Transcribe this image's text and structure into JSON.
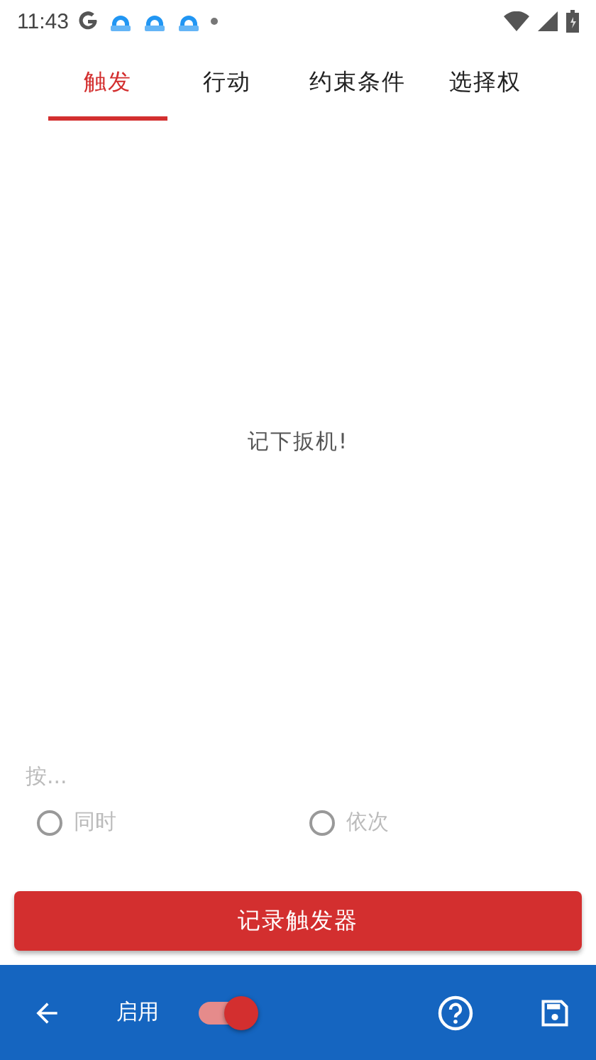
{
  "status_bar": {
    "time": "11:43"
  },
  "tabs": [
    {
      "label": "触发",
      "selected": true
    },
    {
      "label": "行动",
      "selected": false
    },
    {
      "label": "约束条件",
      "selected": false
    },
    {
      "label": "选择权",
      "selected": false
    }
  ],
  "message": "记下扳机!",
  "mode": {
    "label": "按...",
    "disabled": true,
    "options": [
      {
        "label": "同时",
        "selected": false
      },
      {
        "label": "依次",
        "selected": false
      }
    ]
  },
  "record_button": "记录触发器",
  "bottom_bar": {
    "enable_label": "启用",
    "enabled": true
  }
}
